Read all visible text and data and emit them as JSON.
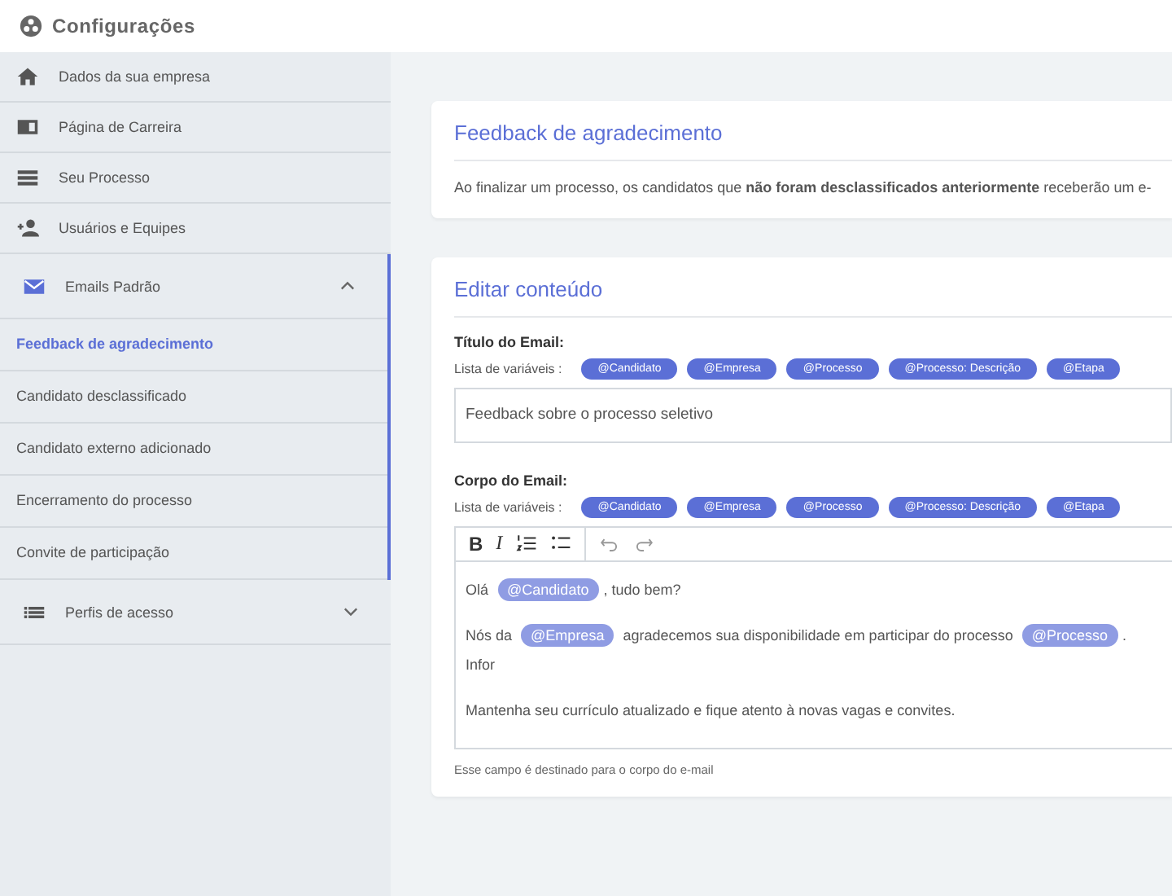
{
  "header": {
    "title": "Configurações"
  },
  "sidebar": {
    "items": [
      {
        "label": "Dados da sua empresa"
      },
      {
        "label": "Página de Carreira"
      },
      {
        "label": "Seu Processo"
      },
      {
        "label": "Usuários e Equipes"
      },
      {
        "label": "Emails Padrão",
        "expanded": true,
        "children": [
          {
            "label": "Feedback de agradecimento",
            "selected": true
          },
          {
            "label": "Candidato desclassificado",
            "selected": false
          },
          {
            "label": "Candidato externo adicionado",
            "selected": false
          },
          {
            "label": "Encerramento do processo",
            "selected": false
          },
          {
            "label": "Convite de participação",
            "selected": false
          }
        ]
      },
      {
        "label": "Perfis de acesso",
        "expanded": false
      }
    ]
  },
  "info_card": {
    "title": "Feedback de agradecimento",
    "text": "Ao finalizar um processo, os candidatos que **não foram desclassificados anteriormente** receberão um e-"
  },
  "edit_card": {
    "title": "Editar conteúdo",
    "subject": {
      "label": "Título do Email:",
      "variables_label": "Lista de variáveis :",
      "variables": [
        "@Candidato",
        "@Empresa",
        "@Processo",
        "@Processo: Descrição",
        "@Etapa"
      ],
      "value": "Feedback sobre o processo seletivo"
    },
    "body": {
      "label": "Corpo do Email:",
      "variables_label": "Lista de variáveis :",
      "variables": [
        "@Candidato",
        "@Empresa",
        "@Processo",
        "@Processo: Descrição",
        "@Etapa"
      ],
      "format_buttons": [
        "B",
        "I"
      ],
      "paragraphs": [
        [
          {
            "kind": "text",
            "text": "Olá"
          },
          {
            "kind": "variable",
            "text": "@Candidato"
          },
          {
            "kind": "text",
            "text": ", tudo bem?"
          }
        ],
        [
          {
            "kind": "text",
            "text": "Nós da"
          },
          {
            "kind": "variable",
            "text": "@Empresa"
          },
          {
            "kind": "text",
            "text": "agradecemos sua disponibilidade em participar do processo"
          },
          {
            "kind": "variable",
            "text": "@Processo"
          },
          {
            "kind": "text",
            "text": ". Infor"
          }
        ],
        [
          {
            "kind": "text",
            "text": "Mantenha seu currículo atualizado e fique atento à novas vagas e convites."
          }
        ]
      ],
      "hint": "Esse campo é destinado para o corpo do e-mail"
    }
  }
}
